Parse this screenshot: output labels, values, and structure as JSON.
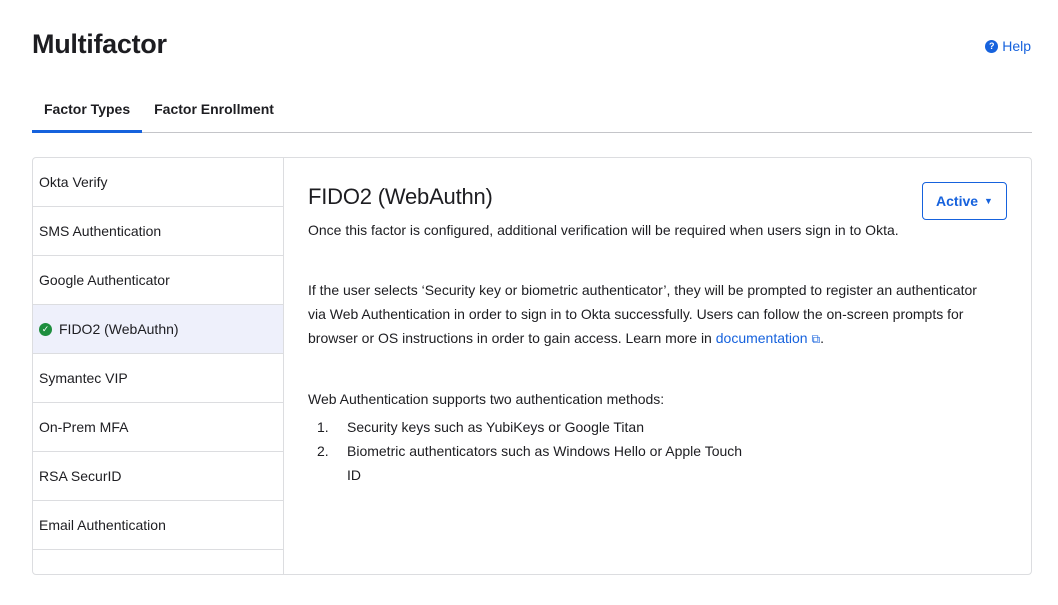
{
  "header": {
    "title": "Multifactor",
    "help_label": "Help"
  },
  "tabs": [
    {
      "label": "Factor Types",
      "active": true
    },
    {
      "label": "Factor Enrollment",
      "active": false
    }
  ],
  "sidebar": {
    "items": [
      {
        "label": "Okta Verify"
      },
      {
        "label": "SMS Authentication"
      },
      {
        "label": "Google Authenticator"
      },
      {
        "label": "FIDO2 (WebAuthn)",
        "selected": true
      },
      {
        "label": "Symantec VIP"
      },
      {
        "label": "On-Prem MFA"
      },
      {
        "label": "RSA SecurID"
      },
      {
        "label": "Email Authentication"
      }
    ]
  },
  "detail": {
    "title": "FIDO2 (WebAuthn)",
    "status_label": "Active",
    "intro": "Once this factor is configured, additional verification will be required when users sign in to Okta.",
    "para2_text": "If the user selects ‘Security key or biometric authenticator’, they will be prompted to register an authenticator via Web Authentication in order to sign in to Okta successfully. Users can follow the on-screen prompts for browser or OS instructions in order to gain access. Learn more in ",
    "para2_link": "documentation",
    "para2_end": ".",
    "methods_intro": "Web Authentication supports two authentication methods:",
    "methods": [
      {
        "num": "1.",
        "text": "Security keys such as YubiKeys or Google Titan"
      },
      {
        "num": "2.",
        "text": "Biometric authenticators such as Windows Hello or Apple Touch ID"
      }
    ]
  },
  "colors": {
    "accent": "#1662dd",
    "selected_bg": "#eef0fb",
    "success": "#1e8e3e"
  }
}
